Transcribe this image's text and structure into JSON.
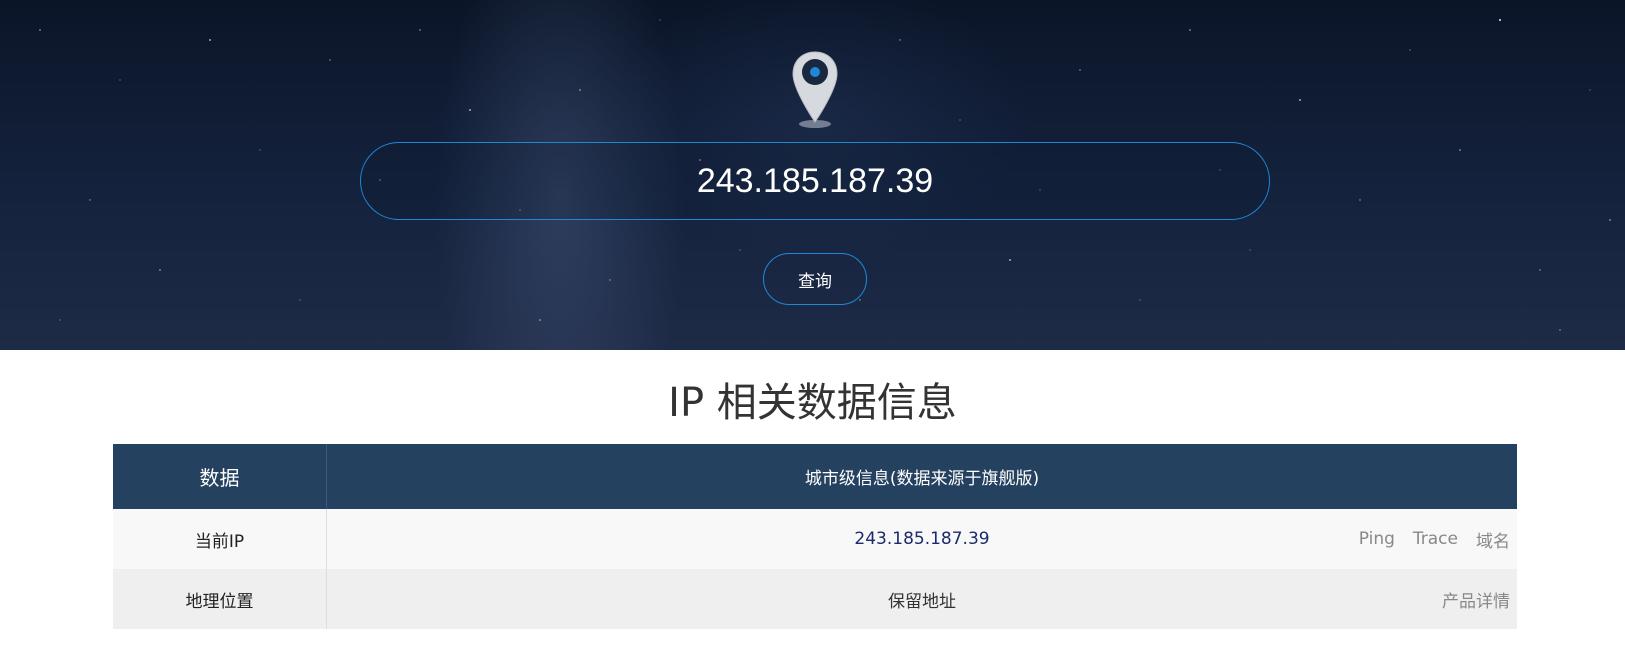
{
  "search": {
    "ip_value": "243.185.187.39",
    "query_label": "查询"
  },
  "section": {
    "title": "IP 相关数据信息"
  },
  "table": {
    "headers": [
      "数据",
      "城市级信息(数据来源于旗舰版)"
    ],
    "rows": [
      {
        "label": "当前IP",
        "value": "243.185.187.39",
        "actions": [
          "Ping",
          "Trace",
          "域名"
        ]
      },
      {
        "label": "地理位置",
        "value": "保留地址",
        "actions": [
          "产品详情"
        ]
      }
    ]
  },
  "colors": {
    "accent": "#1e88d6",
    "header_bg": "#244260",
    "ip_text": "#1b2a6b"
  },
  "icons": {
    "location": "map-pin-icon"
  }
}
